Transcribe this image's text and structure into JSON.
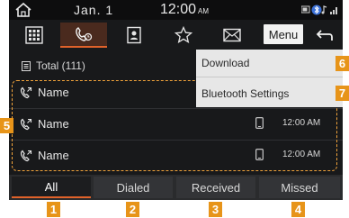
{
  "status": {
    "date": "Jan.  1",
    "time": "12:00",
    "ampm": "AM"
  },
  "tabs": [
    {
      "icon": "keypad-icon"
    },
    {
      "icon": "call-history-icon",
      "active": true
    },
    {
      "icon": "contacts-icon"
    },
    {
      "icon": "favorites-star-icon"
    },
    {
      "icon": "messages-envelope-icon"
    }
  ],
  "menu_button": "Menu",
  "total_label": "Total (111)",
  "dropdown": {
    "items": [
      "Download",
      "Bluetooth Settings"
    ]
  },
  "call_list": [
    {
      "name": "Name",
      "time": ""
    },
    {
      "name": "Name",
      "time": "12:00 AM"
    },
    {
      "name": "Name",
      "time": "12:00 AM"
    }
  ],
  "filters": [
    "All",
    "Dialed",
    "Received",
    "Missed"
  ],
  "active_filter": "All",
  "callouts": [
    "1",
    "2",
    "3",
    "4",
    "5",
    "6",
    "7"
  ],
  "colors": {
    "accent": "#e0622a",
    "callout": "#e79419"
  }
}
